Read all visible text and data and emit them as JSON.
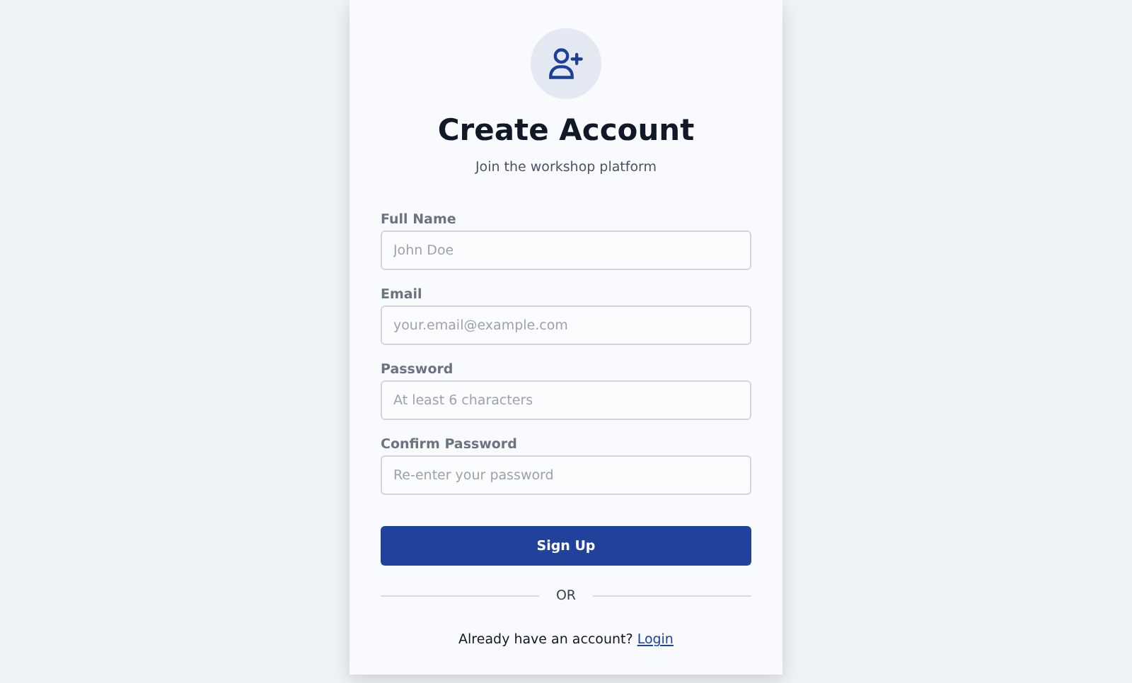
{
  "title": "Create Account",
  "subtitle": "Join the workshop platform",
  "fields": [
    {
      "label": "Full Name",
      "placeholder": "John Doe"
    },
    {
      "label": "Email",
      "placeholder": "your.email@example.com"
    },
    {
      "label": "Password",
      "placeholder": "At least 6 characters"
    },
    {
      "label": "Confirm Password",
      "placeholder": "Re-enter your password"
    }
  ],
  "submit": "Sign Up",
  "divider": "OR",
  "footer": {
    "text": "Already have an account?",
    "link": "Login"
  }
}
